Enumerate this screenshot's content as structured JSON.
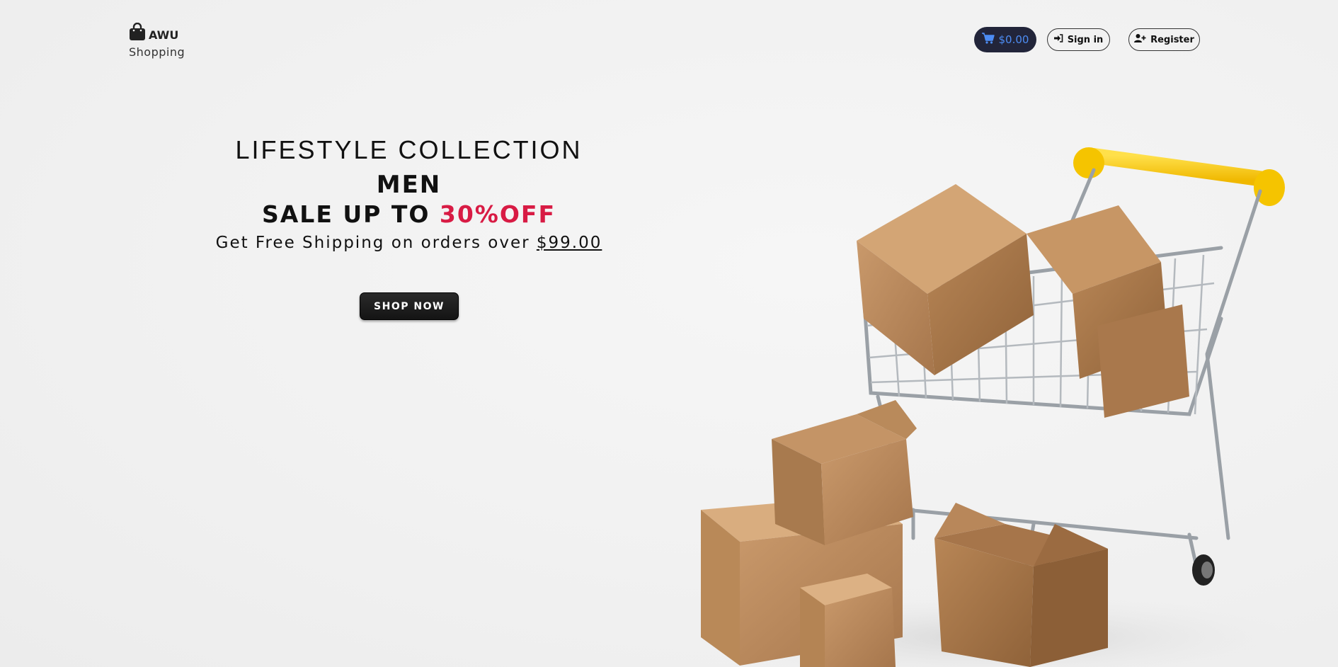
{
  "header": {
    "brand": "AWU",
    "brand_sub": "Shopping",
    "logo_icon": "shopping-bag-icon",
    "cart_total": "$0.00",
    "cart_icon": "cart-icon",
    "sign_in_label": "Sign in",
    "sign_in_icon": "sign-in-icon",
    "register_label": "Register",
    "register_icon": "user-plus-icon"
  },
  "hero": {
    "kicker": "LIFESTYLE COLLECTION",
    "title": "MEN",
    "sale_prefix": "SALE UP TO ",
    "sale_highlight": "30%OFF",
    "shipping_prefix": "Get Free Shipping on orders over ",
    "shipping_amount": "$99.00",
    "cta_label": "SHOP NOW",
    "image": "shopping-cart-with-boxes"
  },
  "colors": {
    "accent": "#d81b44",
    "cart_bg": "#22253a",
    "cart_text": "#4d8df4",
    "cta_bg": "#1c1c1c",
    "page_bg": "#f1f1f1"
  }
}
